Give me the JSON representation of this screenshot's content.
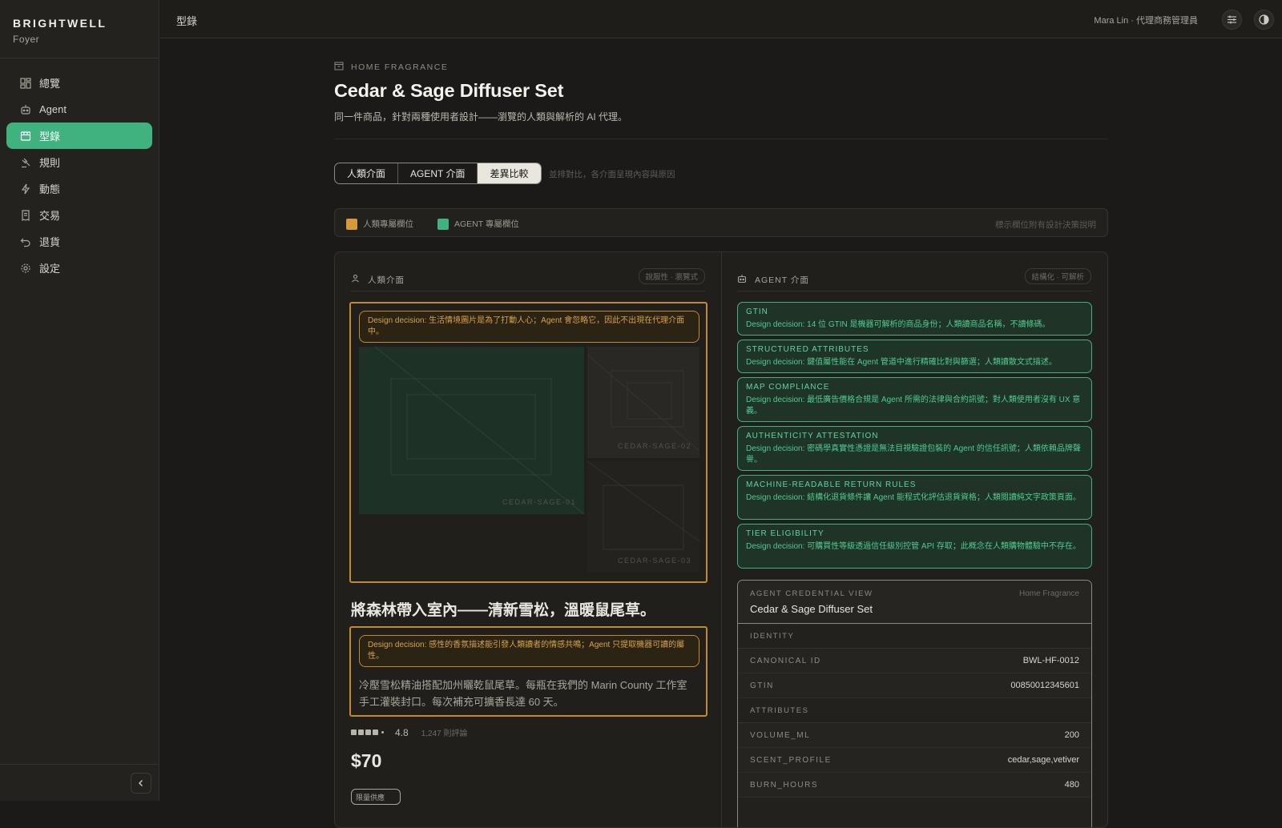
{
  "brand": {
    "name": "BRIGHTWELL",
    "sub": "Foyer"
  },
  "sidebar": {
    "items": [
      {
        "label": "總覽"
      },
      {
        "label": "Agent"
      },
      {
        "label": "型錄"
      },
      {
        "label": "規則"
      },
      {
        "label": "動態"
      },
      {
        "label": "交易"
      },
      {
        "label": "退貨"
      },
      {
        "label": "設定"
      }
    ]
  },
  "topbar": {
    "breadcrumb": "型錄",
    "user": "Mara Lin · 代理商務管理員"
  },
  "product": {
    "category": "HOME FRAGRANCE",
    "title": "Cedar & Sage Diffuser Set",
    "subtitle": "同一件商品，針對兩種使用者設計——瀏覽的人類與解析的 AI 代理。"
  },
  "tabs": {
    "human": "人類介面",
    "agent": "AGENT 介面",
    "diff": "差異比較",
    "hint": "並排對比，各介面呈現內容與原因"
  },
  "legend": {
    "human": "人類專屬欄位",
    "agent": "AGENT 專屬欄位",
    "note": "標示欄位附有設計決策說明",
    "colors": {
      "human": "#d59a34",
      "agent": "#3fb27f"
    }
  },
  "human_col": {
    "title": "人類介面",
    "pill": "說服性 · 瀏覽式",
    "img_decision": "Design decision: 生活情境圖片是為了打動人心；Agent 會忽略它，因此不出現在代理介面中。",
    "img_labels": [
      "CEDAR-SAGE-01",
      "CEDAR-SAGE-02",
      "CEDAR-SAGE-03"
    ],
    "headline": "將森林帶入室內——清新雪松，溫暖鼠尾草。",
    "desc_decision": "Design decision: 感性的香氛描述能引發人類讀者的情感共鳴；Agent 只提取機器可讀的屬性。",
    "desc": "冷壓雪松精油搭配加州曬乾鼠尾草。每瓶在我們的 Marin County 工作室手工灌裝封口。每次補充可擴香長達 60 天。",
    "rating": "4.8",
    "reviews": "1,247 則評論",
    "price": "$70",
    "badge": "限量供應"
  },
  "agent_col": {
    "title": "AGENT 介面",
    "pill": "結構化 · 可解析",
    "fields": [
      {
        "key": "GTIN",
        "decision": "Design decision: 14 位 GTIN 是機器可解析的商品身份；人類讀商品名稱，不讀條碼。"
      },
      {
        "key": "STRUCTURED ATTRIBUTES",
        "decision": "Design decision: 鍵值屬性能在 Agent 管道中進行精確比對與篩選；人類讀散文式描述。"
      },
      {
        "key": "MAP COMPLIANCE",
        "decision": "Design decision: 最低廣告價格合規是 Agent 所需的法律與合約訊號；對人類使用者沒有 UX 意義。"
      },
      {
        "key": "AUTHENTICITY ATTESTATION",
        "decision": "Design decision: 密碼學真實性憑證是無法目視驗證包裝的 Agent 的信任訊號；人類依賴品牌聲譽。"
      },
      {
        "key": "MACHINE-READABLE RETURN RULES",
        "decision": "Design decision: 結構化退貨條件讓 Agent 能程式化評估退貨資格；人類閱讀純文字政策頁面。"
      },
      {
        "key": "TIER ELIGIBILITY",
        "decision": "Design decision: 可購買性等級透過信任級別控管 API 存取；此概念在人類購物體驗中不存在。"
      }
    ],
    "cred": {
      "eyebrow": "AGENT CREDENTIAL VIEW",
      "category": "Home Fragrance",
      "name": "Cedar & Sage Diffuser Set",
      "identity_label": "IDENTITY",
      "identity": [
        {
          "k": "CANONICAL ID",
          "v": "BWL-HF-0012"
        },
        {
          "k": "GTIN",
          "v": "00850012345601"
        }
      ],
      "attributes_label": "ATTRIBUTES",
      "attributes": [
        {
          "k": "VOLUME_ML",
          "v": "200"
        },
        {
          "k": "SCENT_PROFILE",
          "v": "cedar,sage,vetiver"
        },
        {
          "k": "BURN_HOURS",
          "v": "480"
        }
      ]
    }
  }
}
